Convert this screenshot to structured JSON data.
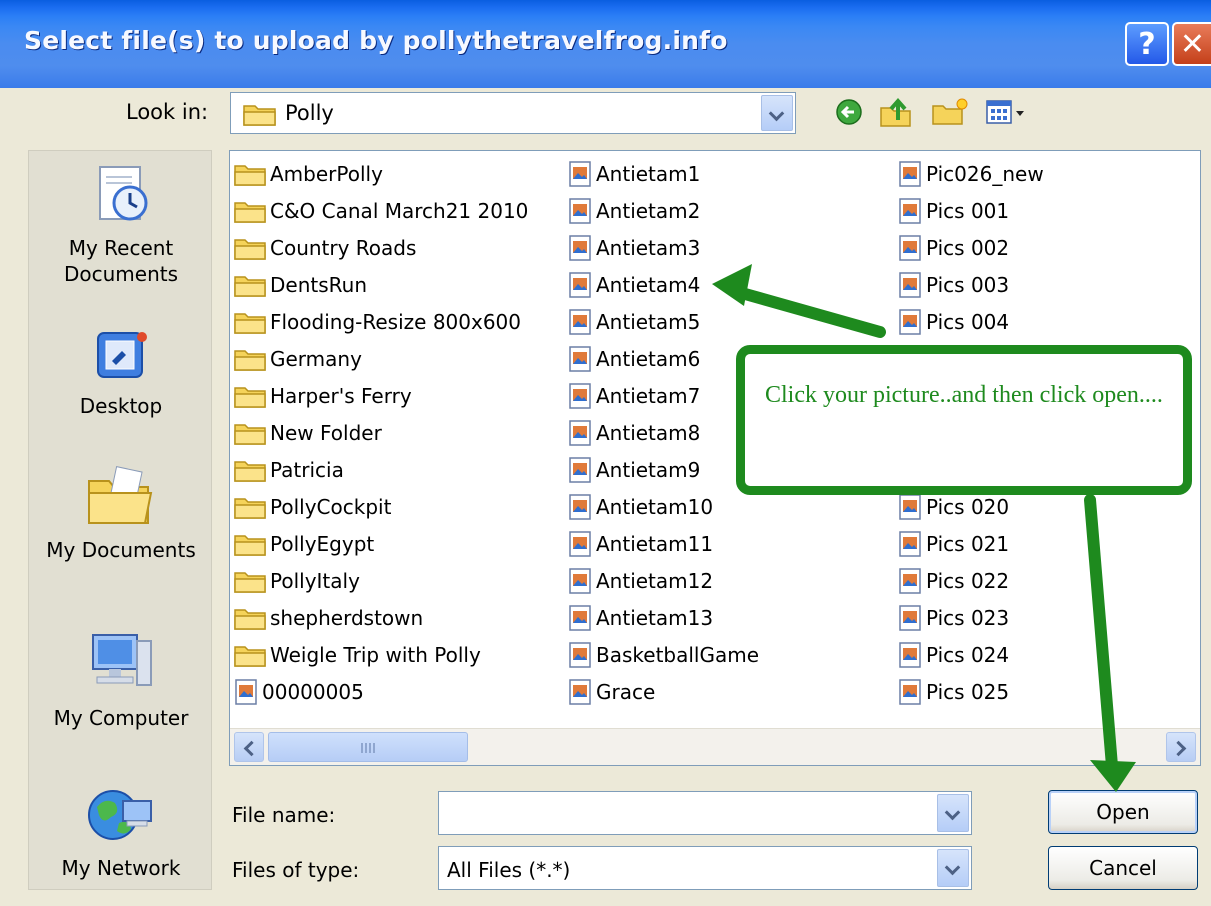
{
  "window": {
    "title": "Select file(s) to upload by pollythetravelfrog.info",
    "help_button": "?",
    "close_button": "✕"
  },
  "toolbar": {
    "look_in_label": "Look in:",
    "look_in_value": "Polly",
    "icons": [
      "back-icon",
      "up-folder-icon",
      "new-folder-icon",
      "views-menu-icon"
    ]
  },
  "places": [
    {
      "label_lines": [
        "My Recent",
        "Documents"
      ],
      "icon": "recent-documents-icon"
    },
    {
      "label_lines": [
        "Desktop"
      ],
      "icon": "desktop-icon"
    },
    {
      "label_lines": [
        "My Documents"
      ],
      "icon": "my-documents-icon"
    },
    {
      "label_lines": [
        "My Computer"
      ],
      "icon": "my-computer-icon"
    },
    {
      "label_lines": [
        "My Network"
      ],
      "icon": "my-network-icon"
    }
  ],
  "files": {
    "columns": [
      [
        {
          "name": "AmberPolly",
          "type": "folder"
        },
        {
          "name": "C&O Canal March21 2010",
          "type": "folder"
        },
        {
          "name": "Country Roads",
          "type": "folder"
        },
        {
          "name": "DentsRun",
          "type": "folder"
        },
        {
          "name": "Flooding-Resize 800x600",
          "type": "folder"
        },
        {
          "name": "Germany",
          "type": "folder"
        },
        {
          "name": "Harper's Ferry",
          "type": "folder"
        },
        {
          "name": "New Folder",
          "type": "folder"
        },
        {
          "name": "Patricia",
          "type": "folder"
        },
        {
          "name": "PollyCockpit",
          "type": "folder"
        },
        {
          "name": "PollyEgypt",
          "type": "folder"
        },
        {
          "name": "PollyItaly",
          "type": "folder"
        },
        {
          "name": "shepherdstown",
          "type": "folder"
        },
        {
          "name": "Weigle Trip with Polly",
          "type": "folder"
        },
        {
          "name": "00000005",
          "type": "image"
        }
      ],
      [
        {
          "name": "Antietam1",
          "type": "image"
        },
        {
          "name": "Antietam2",
          "type": "image"
        },
        {
          "name": "Antietam3",
          "type": "image"
        },
        {
          "name": "Antietam4",
          "type": "image"
        },
        {
          "name": "Antietam5",
          "type": "image"
        },
        {
          "name": "Antietam6",
          "type": "image"
        },
        {
          "name": "Antietam7",
          "type": "image"
        },
        {
          "name": "Antietam8",
          "type": "image"
        },
        {
          "name": "Antietam9",
          "type": "image"
        },
        {
          "name": "Antietam10",
          "type": "image"
        },
        {
          "name": "Antietam11",
          "type": "image"
        },
        {
          "name": "Antietam12",
          "type": "image"
        },
        {
          "name": "Antietam13",
          "type": "image"
        },
        {
          "name": "BasketballGame",
          "type": "image"
        },
        {
          "name": "Grace",
          "type": "image"
        }
      ],
      [
        {
          "name": "Pic026_new",
          "type": "image"
        },
        {
          "name": "Pics 001",
          "type": "image"
        },
        {
          "name": "Pics 002",
          "type": "image"
        },
        {
          "name": "Pics 003",
          "type": "image"
        },
        {
          "name": "Pics 004",
          "type": "image"
        },
        {
          "name": "",
          "type": "image"
        },
        {
          "name": "",
          "type": "image"
        },
        {
          "name": "",
          "type": "image"
        },
        {
          "name": "",
          "type": "image"
        },
        {
          "name": "Pics 020",
          "type": "image"
        },
        {
          "name": "Pics 021",
          "type": "image"
        },
        {
          "name": "Pics 022",
          "type": "image"
        },
        {
          "name": "Pics 023",
          "type": "image"
        },
        {
          "name": "Pics 024",
          "type": "image"
        },
        {
          "name": "Pics 025",
          "type": "image"
        }
      ]
    ]
  },
  "form": {
    "file_name_label": "File name:",
    "file_name_value": "",
    "file_type_label": "Files of type:",
    "file_type_value": "All Files (*.*)"
  },
  "buttons": {
    "open": "Open",
    "cancel": "Cancel"
  },
  "annotation": {
    "callout_text": "Click your picture..and then click open....",
    "color": "#1e8a1e"
  }
}
